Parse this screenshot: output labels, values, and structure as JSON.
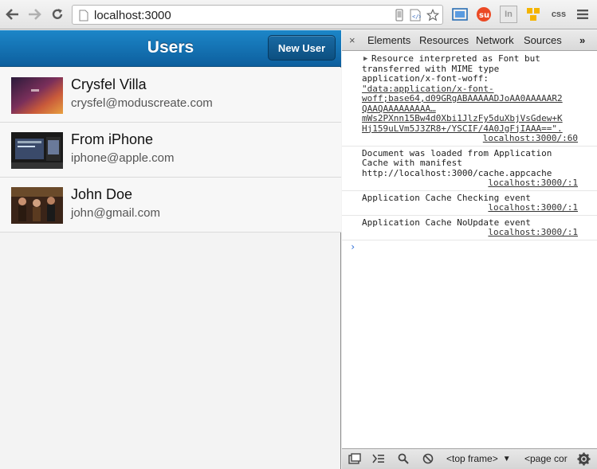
{
  "browser": {
    "url": "localhost:3000",
    "icons": [
      "back-icon",
      "forward-icon",
      "reload-icon",
      "page-icon",
      "mobile-icon",
      "code-icon",
      "star-icon"
    ],
    "extensions": {
      "ext_in": "In",
      "ext_css": "css"
    }
  },
  "app": {
    "title": "Users",
    "new_user_label": "New User",
    "users": [
      {
        "name": "Crysfel Villa",
        "email": "crysfel@moduscreate.com"
      },
      {
        "name": "From iPhone",
        "email": "iphone@apple.com"
      },
      {
        "name": "John Doe",
        "email": "john@gmail.com"
      }
    ]
  },
  "devtools": {
    "tabs": [
      "Elements",
      "Resources",
      "Network",
      "Sources"
    ],
    "more": "»",
    "close": "×",
    "messages": [
      {
        "lines": [
          "Resource interpreted as Font but",
          "transferred with MIME type",
          "application/x-font-woff:"
        ],
        "link_lines": [
          "\"data:application/x-font-",
          "woff;base64,d09GRgABAAAAADJoAA0AAAAAR2",
          "QAAQAAAAAAAAA…",
          "mWs2PXnn15Bw4d0Xbi1JlzFy5duXbjVsGdew+K",
          "Hj159uLVm5J3ZR8+/YSCIF/4A0JgFjIAAA==\"."
        ],
        "source": "localhost:3000/:60"
      },
      {
        "lines": [
          "Document was loaded from Application",
          "Cache with manifest",
          "http://localhost:3000/cache.appcache"
        ],
        "source": "localhost:3000/:1"
      },
      {
        "lines": [
          "Application Cache Checking event"
        ],
        "source": "localhost:3000/:1"
      },
      {
        "lines": [
          "Application Cache NoUpdate event"
        ],
        "source": "localhost:3000/:1"
      }
    ],
    "prompt": "›",
    "frame_select": "<top frame>",
    "page_context": "<page cor"
  },
  "colors": {
    "titlebar": "#1475b8",
    "prompt": "#2f6fd6"
  }
}
